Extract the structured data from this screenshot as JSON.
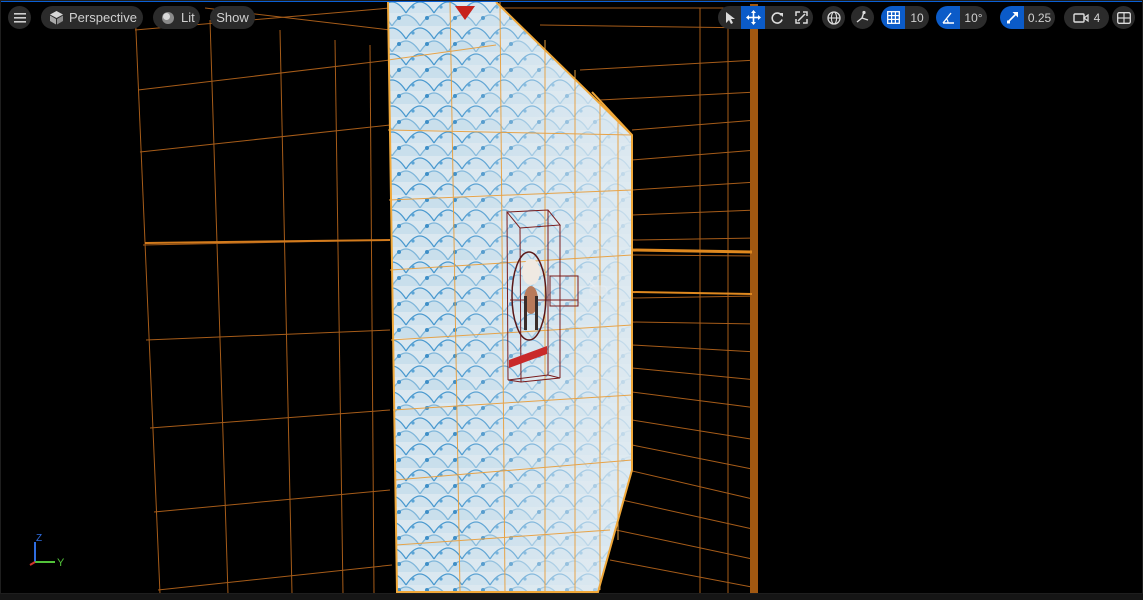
{
  "toolbar": {
    "view_mode": "Perspective",
    "lighting_mode": "Lit",
    "show_label": "Show",
    "transform_tools": [
      "select",
      "translate",
      "rotate",
      "scale"
    ],
    "active_tool": "translate",
    "grid_snap_value": "10",
    "rotation_snap_value": "10°",
    "scale_snap_value": "0.25",
    "camera_speed_value": "4"
  },
  "axis_gizmo": {
    "z_label": "Z",
    "y_label": "Y"
  },
  "colors": {
    "accent": "#0b5bc8",
    "selection_wire": "#e8922a",
    "wall_fill": "#d7e6ef",
    "wall_pattern": "#4c9cd0"
  },
  "icons": {
    "menu": "hamburger-icon",
    "perspective": "cube-icon",
    "lit": "sphere-icon",
    "select": "cursor-icon",
    "translate": "move-arrows-icon",
    "rotate": "rotate-icon",
    "scale": "scale-icon",
    "world": "globe-icon",
    "surface_snap": "surface-snap-icon",
    "grid": "grid-icon",
    "angle": "angle-icon",
    "scale_snap": "diagonal-arrow-icon",
    "camera": "camera-icon",
    "layout": "viewport-layout-icon"
  }
}
